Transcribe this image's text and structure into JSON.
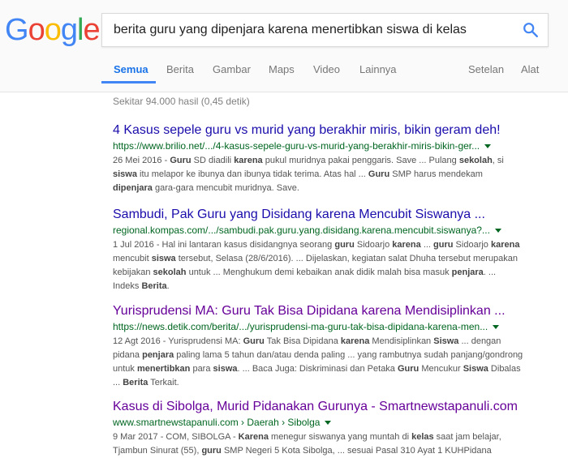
{
  "logo": {
    "letters": [
      "G",
      "o",
      "o",
      "g",
      "l",
      "e"
    ],
    "colors": [
      "#4285f4",
      "#ea4335",
      "#fbbc05",
      "#4285f4",
      "#34a853",
      "#ea4335"
    ]
  },
  "search": {
    "value": "berita guru yang dipenjara karena menertibkan siswa di kelas",
    "icon": "search-icon"
  },
  "tabs": {
    "all": "Semua",
    "news": "Berita",
    "images": "Gambar",
    "maps": "Maps",
    "video": "Video",
    "more": "Lainnya",
    "settings": "Setelan",
    "tools": "Alat"
  },
  "stats": "Sekitar 94.000 hasil (0,45 detik)",
  "results": [
    {
      "title": "4 Kasus sepele guru vs murid yang berakhir miris, bikin geram deh!",
      "url": "https://www.brilio.net/.../4-kasus-sepele-guru-vs-murid-yang-berakhir-miris-bikin-ger...",
      "snippet_lines": [
        [
          [
            "26 Mei 2016 - ",
            false
          ],
          [
            "Guru",
            true
          ],
          [
            " SD diadili ",
            false
          ],
          [
            "karena",
            true
          ],
          [
            " pukul muridnya pakai penggaris. Save ... Pulang ",
            false
          ],
          [
            "sekolah",
            true
          ],
          [
            ", si",
            false
          ]
        ],
        [
          [
            "siswa",
            true
          ],
          [
            " itu melapor ke ibunya dan ibunya tidak terima. Atas hal ... ",
            false
          ],
          [
            "Guru",
            true
          ],
          [
            " SMP harus mendekam",
            false
          ]
        ],
        [
          [
            "dipenjara",
            true
          ],
          [
            " gara-gara mencubit muridnya. Save.",
            false
          ]
        ]
      ]
    },
    {
      "title": "Sambudi, Pak Guru yang Disidang karena Mencubit Siswanya ...",
      "url": "regional.kompas.com/.../sambudi.pak.guru.yang.disidang.karena.mencubit.siswanya?...",
      "snippet_lines": [
        [
          [
            "1 Jul 2016 - Hal ini lantaran kasus disidangnya seorang ",
            false
          ],
          [
            "guru",
            true
          ],
          [
            " Sidoarjo ",
            false
          ],
          [
            "karena",
            true
          ],
          [
            " ... ",
            false
          ],
          [
            "guru",
            true
          ],
          [
            " Sidoarjo ",
            false
          ],
          [
            "karena",
            true
          ]
        ],
        [
          [
            "mencubit ",
            false
          ],
          [
            "siswa",
            true
          ],
          [
            " tersebut, Selasa (28/6/2016). ... Dijelaskan, kegiatan salat Dhuha tersebut merupakan",
            false
          ]
        ],
        [
          [
            "kebijakan ",
            false
          ],
          [
            "sekolah",
            true
          ],
          [
            " untuk ... Menghukum demi kebaikan anak didik malah bisa masuk ",
            false
          ],
          [
            "penjara",
            true
          ],
          [
            ". ...",
            false
          ]
        ],
        [
          [
            "Indeks ",
            false
          ],
          [
            "Berita",
            true
          ],
          [
            ".",
            false
          ]
        ]
      ]
    },
    {
      "title": "Yurisprudensi MA: Guru Tak Bisa Dipidana karena Mendisiplinkan ...",
      "url": "https://news.detik.com/berita/.../yurisprudensi-ma-guru-tak-bisa-dipidana-karena-men...",
      "snippet_lines": [
        [
          [
            "12 Agt 2016 - Yurisprudensi MA: ",
            false
          ],
          [
            "Guru",
            true
          ],
          [
            " Tak Bisa Dipidana ",
            false
          ],
          [
            "karena",
            true
          ],
          [
            " Mendisiplinkan ",
            false
          ],
          [
            "Siswa",
            true
          ],
          [
            " ... dengan",
            false
          ]
        ],
        [
          [
            "pidana ",
            false
          ],
          [
            "penjara",
            true
          ],
          [
            " paling lama 5 tahun dan/atau denda paling ... yang rambutnya sudah panjang/gondrong",
            false
          ]
        ],
        [
          [
            "untuk ",
            false
          ],
          [
            "menertibkan",
            true
          ],
          [
            " para ",
            false
          ],
          [
            "siswa",
            true
          ],
          [
            ". ... Baca Juga: Diskriminasi dan Petaka ",
            false
          ],
          [
            "Guru",
            true
          ],
          [
            " Mencukur ",
            false
          ],
          [
            "Siswa",
            true
          ],
          [
            " Dibalas",
            false
          ]
        ],
        [
          [
            "... ",
            false
          ],
          [
            "Berita",
            true
          ],
          [
            " Terkait.",
            false
          ]
        ]
      ]
    },
    {
      "title": "Kasus di Sibolga, Murid Pidanakan Gurunya - Smartnewstapanuli.com",
      "url": "www.smartnewstapanuli.com › Daerah › Sibolga",
      "snippet_lines": [
        [
          [
            "9 Mar 2017 - COM, SIBOLGA - ",
            false
          ],
          [
            "Karena",
            true
          ],
          [
            " menegur siswanya yang muntah di ",
            false
          ],
          [
            "kelas",
            true
          ],
          [
            " saat jam belajar,",
            false
          ]
        ],
        [
          [
            "Tjambun Sinurat (55), ",
            false
          ],
          [
            "guru",
            true
          ],
          [
            " SMP Negeri 5 Kota Sibolga, ... sesuai Pasal 310 Ayat 1 KUHPidana",
            false
          ]
        ]
      ]
    }
  ]
}
